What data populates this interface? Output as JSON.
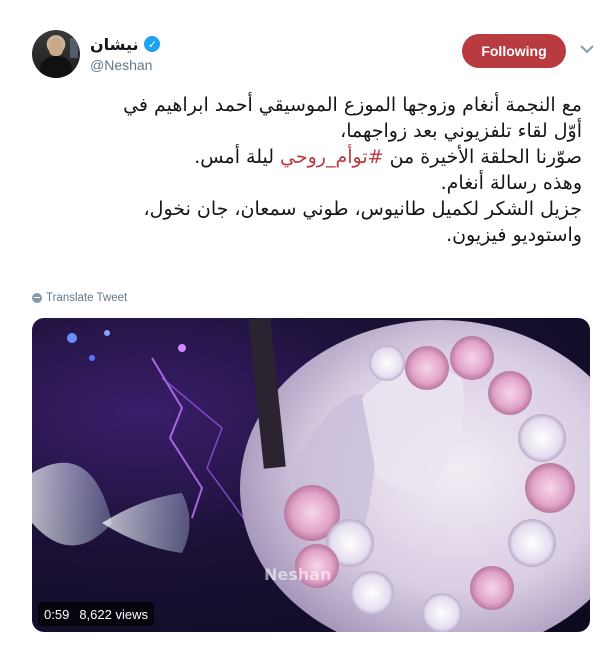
{
  "tweet": {
    "author": {
      "display_name": "نيشان",
      "handle": "@Neshan",
      "verified": true
    },
    "follow_button_label": "Following",
    "text_lines": [
      {
        "parts": [
          {
            "text": "مع النجمة أنغام وزوجها الموزع الموسيقي أحمد ابراهيم في",
            "hashtag": false
          }
        ]
      },
      {
        "parts": [
          {
            "text": "أوّل لقاء تلفزيوني بعد زواجهما،",
            "hashtag": false
          }
        ]
      },
      {
        "parts": [
          {
            "text": "صوّرنا الحلقة الأخيرة من ",
            "hashtag": false
          },
          {
            "text": "#توأم_روحي",
            "hashtag": true
          },
          {
            "text": " ليلة أمس.",
            "hashtag": false
          }
        ]
      },
      {
        "parts": [
          {
            "text": "وهذه رسالة أنغام.",
            "hashtag": false
          }
        ]
      },
      {
        "parts": [
          {
            "text": "جزيل الشكر لكميل طانيوس، طوني سمعان، جان نخول،",
            "hashtag": false
          }
        ]
      },
      {
        "parts": [
          {
            "text": "واستوديو فيزيون.",
            "hashtag": false
          }
        ]
      }
    ],
    "translate_label": "Translate Tweet",
    "media": {
      "duration": "0:59",
      "views": "8,622 views",
      "watermark": "Neshan"
    }
  },
  "colors": {
    "accent": "#b83b3f",
    "verified_blue": "#1da1f2",
    "secondary_text": "#657786"
  }
}
